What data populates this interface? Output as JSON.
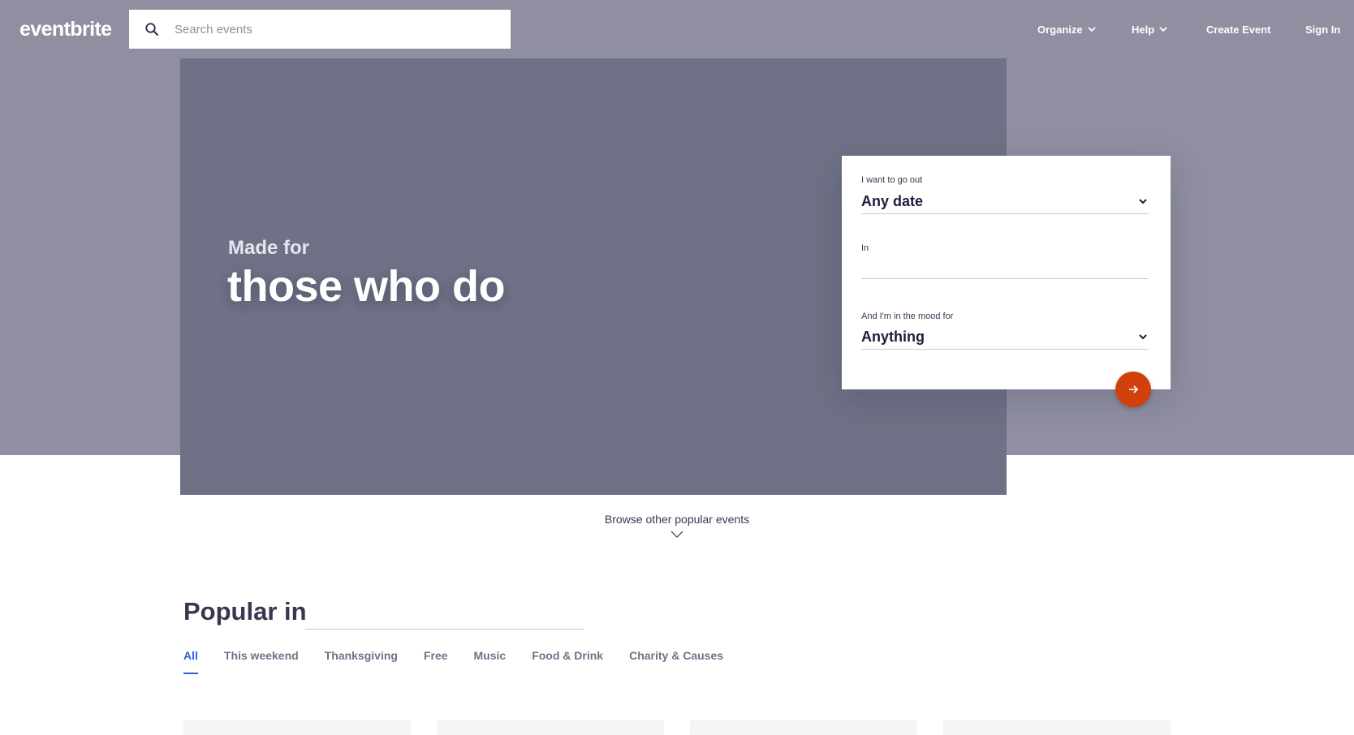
{
  "header": {
    "logo": "eventbrite",
    "search_placeholder": "Search events",
    "nav": {
      "organize": "Organize",
      "help": "Help",
      "create_event": "Create Event",
      "sign_in": "Sign In"
    }
  },
  "hero": {
    "subtitle": "Made for",
    "title": "those who do"
  },
  "search_card": {
    "when_label": "I want to go out",
    "when_value": "Any date",
    "where_label": "In",
    "where_value": "",
    "mood_label": "And I'm in the mood for",
    "mood_value": "Anything"
  },
  "browse": {
    "label": "Browse other popular events"
  },
  "popular": {
    "title": "Popular in",
    "location_value": "",
    "tabs": [
      {
        "label": "All",
        "active": true
      },
      {
        "label": "This weekend",
        "active": false
      },
      {
        "label": "Thanksgiving",
        "active": false
      },
      {
        "label": "Free",
        "active": false
      },
      {
        "label": "Music",
        "active": false
      },
      {
        "label": "Food & Drink",
        "active": false
      },
      {
        "label": "Charity & Causes",
        "active": false
      }
    ]
  },
  "icons": {
    "search": "search-icon",
    "chevron": "chevron-down-icon",
    "arrow": "arrow-right-icon"
  },
  "colors": {
    "header_band": "#8f8fa1",
    "hero": "#6f7186",
    "accent": "#d1410c",
    "tab_active": "#3659e3"
  }
}
